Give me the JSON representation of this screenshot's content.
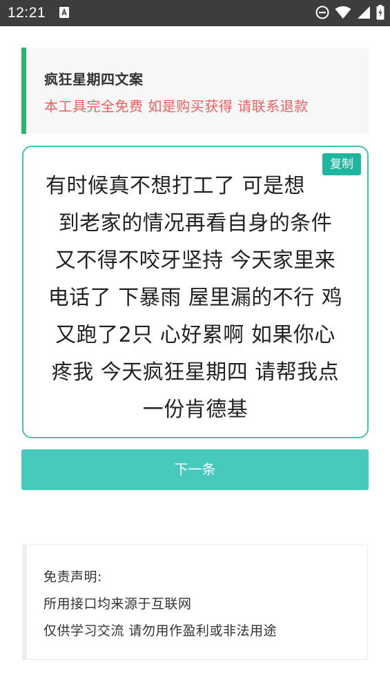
{
  "status_bar": {
    "time": "12:21",
    "icons": [
      "notification-a-icon",
      "do-not-disturb-icon",
      "wifi-icon",
      "signal-icon",
      "battery-charging-icon"
    ]
  },
  "header": {
    "title": "疯狂星期四文案",
    "notice": "本工具完全免费 如是购买获得 请联系退款"
  },
  "copy_card": {
    "copy_label": "复制",
    "lines": [
      "有时候真不想打工了 可是想",
      "到老家的情况再看自身的条件",
      "又不得不咬牙坚持 今天家里来",
      "电话了 下暴雨 屋里漏的不行 鸡",
      "又跑了2只 心好累啊 如果你心",
      "疼我 今天疯狂星期四 请帮我点",
      "一份肯德基"
    ]
  },
  "next_button": {
    "label": "下一条"
  },
  "disclaimer": {
    "title": "免责声明:",
    "line1": "所用接口均来源于互联网",
    "line2": "仅供学习交流 请勿用作盈利或非法用途"
  },
  "colors": {
    "status_bar": "#3d3d3d",
    "accent_green": "#2db46c",
    "notice_red": "#f25c5c",
    "teal_border": "#3ec6b2",
    "copy_button": "#1fb69f",
    "next_button": "#47c9bb"
  }
}
